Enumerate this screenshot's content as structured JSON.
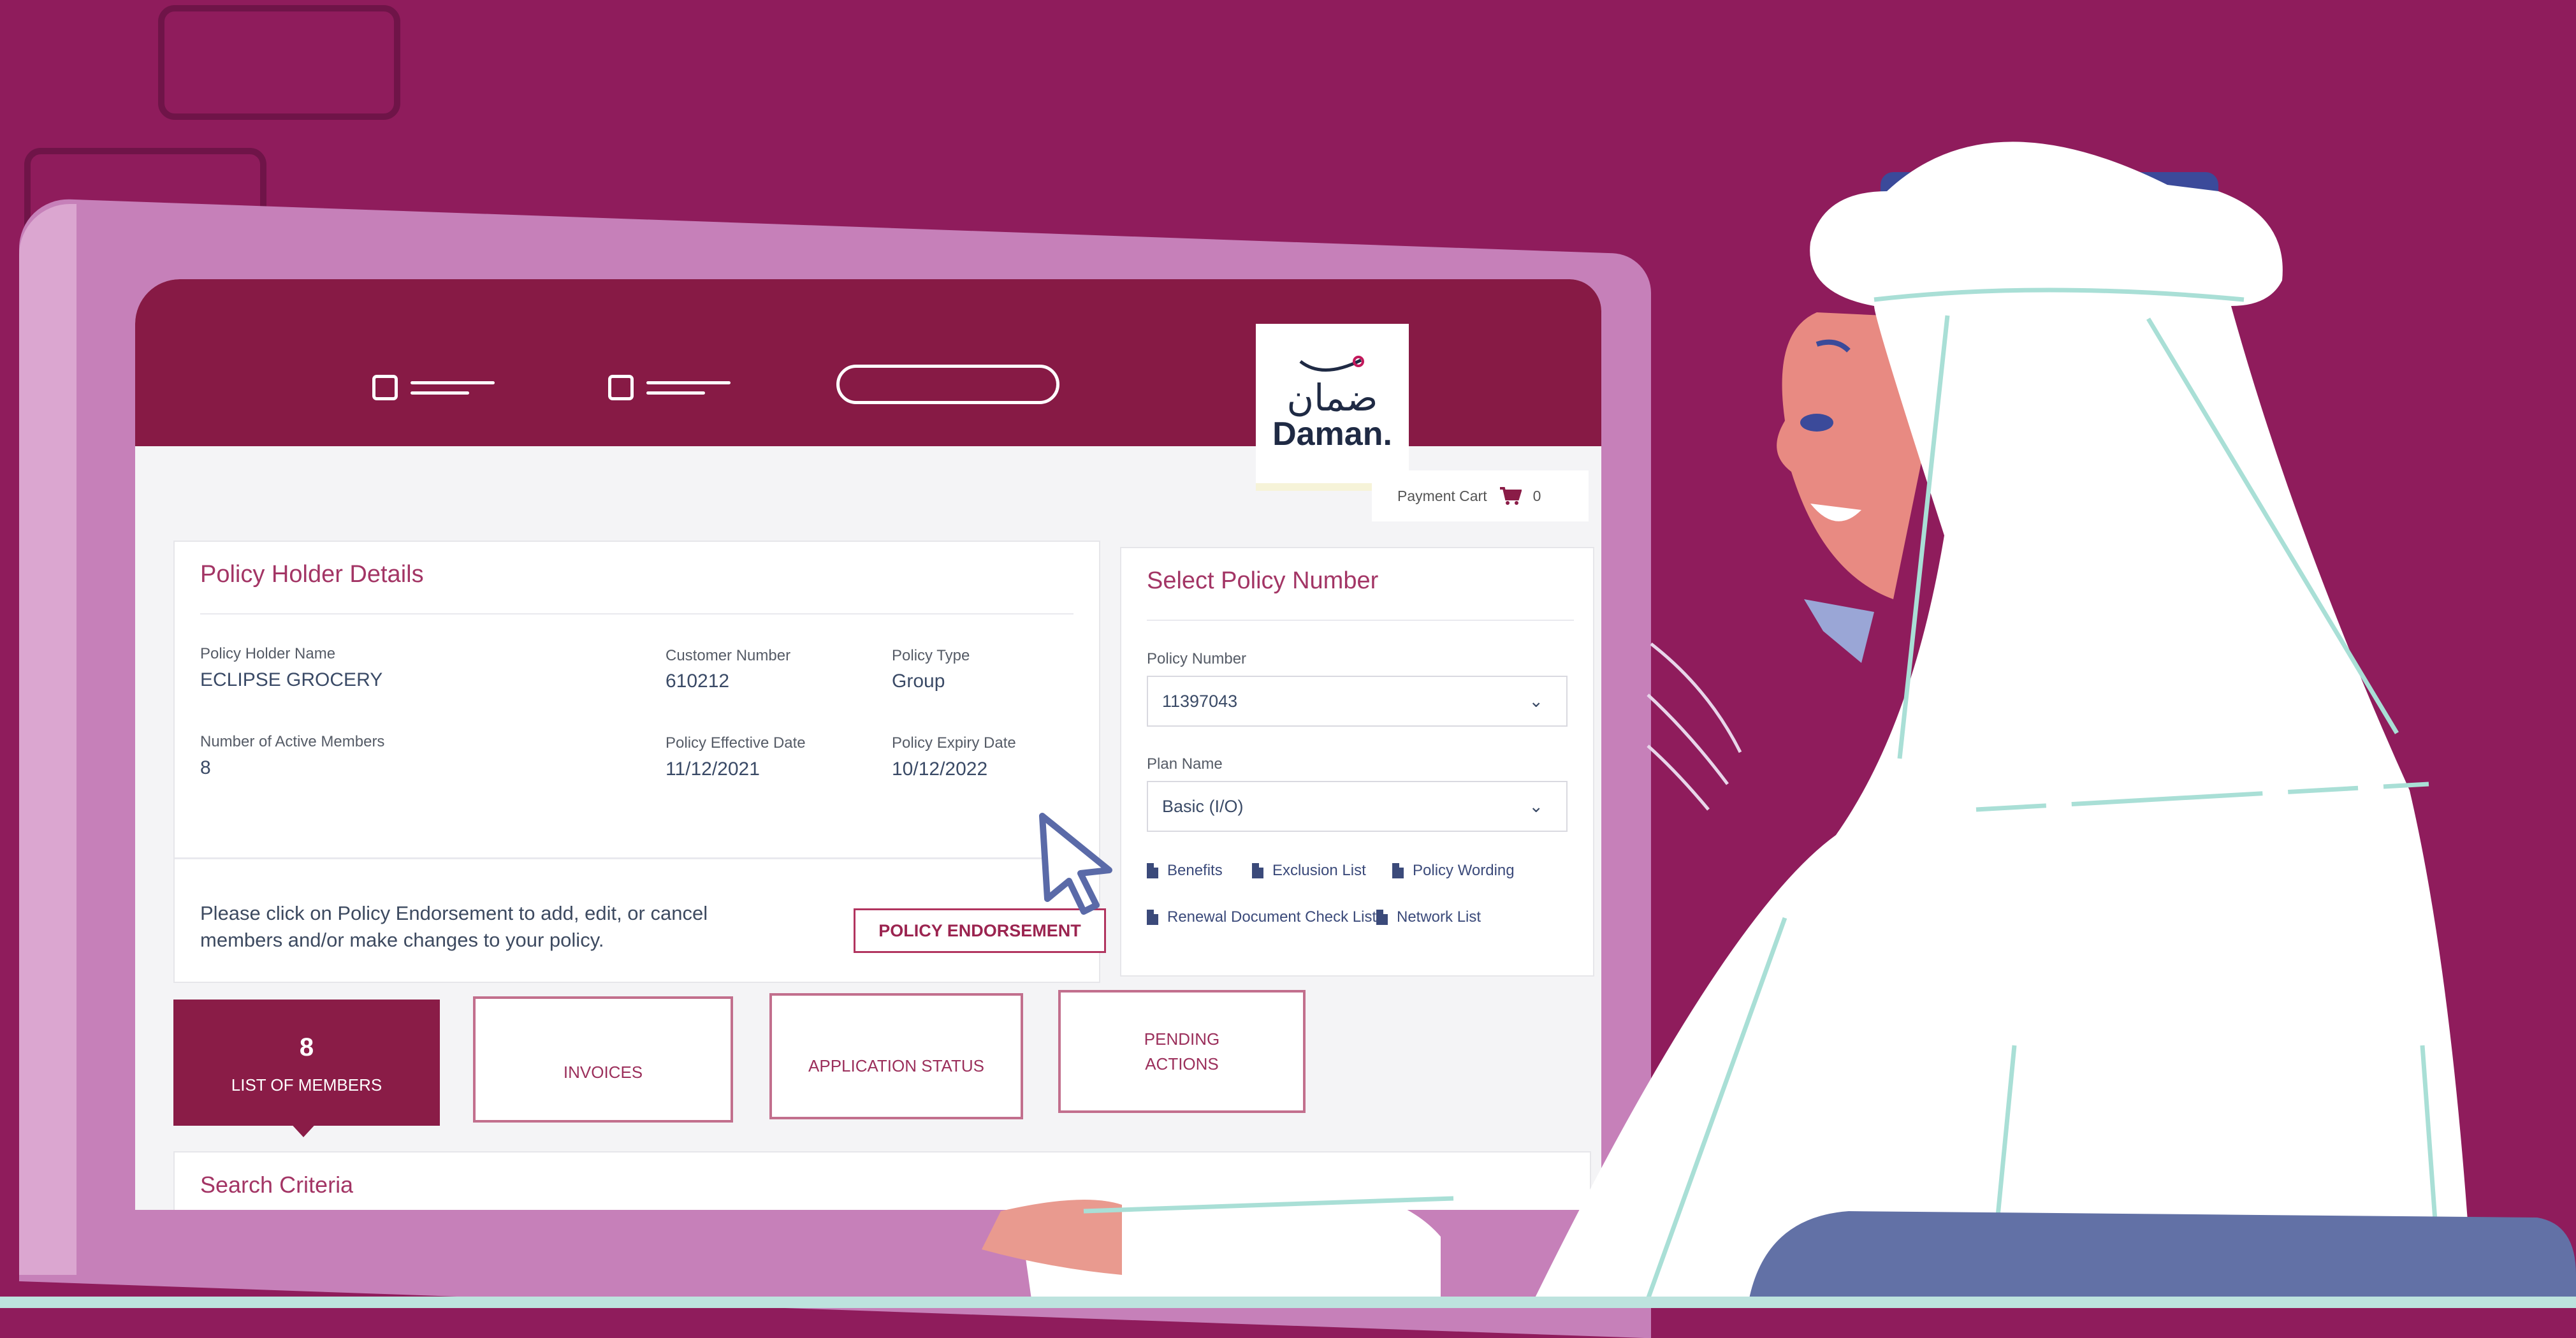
{
  "header": {
    "logo_arabic": "ضمان",
    "logo_latin": "Daman."
  },
  "cart": {
    "label": "Payment Cart",
    "count": "0"
  },
  "policy_holder": {
    "title": "Policy Holder Details",
    "holder_name_label": "Policy Holder Name",
    "holder_name_value": "ECLIPSE GROCERY",
    "customer_number_label": "Customer Number",
    "customer_number_value": "610212",
    "policy_type_label": "Policy Type",
    "policy_type_value": "Group",
    "active_members_label": "Number of Active Members",
    "active_members_value": "8",
    "effective_date_label": "Policy Effective Date",
    "effective_date_value": "11/12/2021",
    "expiry_date_label": "Policy Expiry Date",
    "expiry_date_value": "10/12/2022",
    "endorsement_text": "Please click on Policy Endorsement to add, edit, or cancel members and/or make changes to your policy.",
    "endorsement_button": "POLICY ENDORSEMENT"
  },
  "select_policy": {
    "title": "Select Policy Number",
    "policy_number_label": "Policy Number",
    "policy_number_value": "11397043",
    "plan_name_label": "Plan Name",
    "plan_name_value": "Basic (I/O)",
    "links": [
      "Benefits",
      "Exclusion List",
      "Policy Wording",
      "Renewal Document Check List",
      "Network List"
    ]
  },
  "tabs": {
    "members_count": "8",
    "members_label": "LIST OF MEMBERS",
    "invoices_label": "INVOICES",
    "application_status_label": "APPLICATION STATUS",
    "pending_actions_line1": "PENDING",
    "pending_actions_line2": "ACTIONS"
  },
  "search": {
    "title": "Search Criteria"
  },
  "colors": {
    "background": "#8f1c5c",
    "brand": "#871a45",
    "accent_text": "#a33565",
    "monitor": "#c680b9"
  }
}
